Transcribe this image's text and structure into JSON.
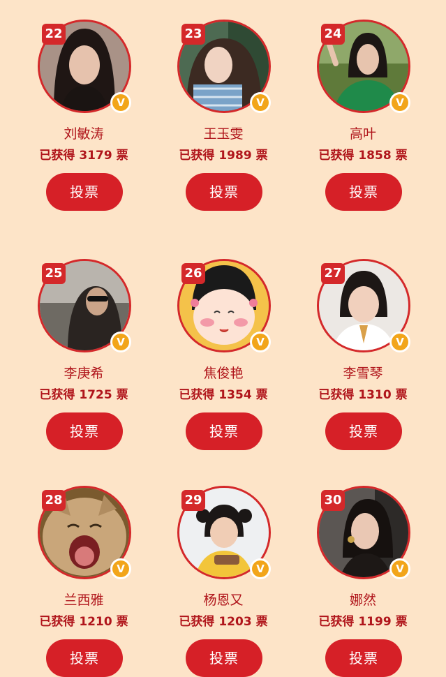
{
  "vote_label": "投票",
  "votes_prefix": "已获得",
  "votes_suffix": "票",
  "verified_glyph": "V",
  "colors": {
    "background": "#fde4c8",
    "accent_red": "#d62027",
    "text_red": "#b0151b",
    "badge_gold": "#f2a51a"
  },
  "candidates": [
    {
      "rank": "22",
      "name": "刘敏涛",
      "votes": "3179",
      "photo": "woman-dark-hair-portrait"
    },
    {
      "rank": "23",
      "name": "王玉雯",
      "votes": "1989",
      "photo": "woman-curly-hair-selfie"
    },
    {
      "rank": "24",
      "name": "高叶",
      "votes": "1858",
      "photo": "woman-green-dress-waving"
    },
    {
      "rank": "25",
      "name": "李庚希",
      "votes": "1725",
      "photo": "person-sunglasses-outdoor"
    },
    {
      "rank": "26",
      "name": "焦俊艳",
      "votes": "1354",
      "photo": "cartoon-girl-pink-cheeks"
    },
    {
      "rank": "27",
      "name": "李雪琴",
      "votes": "1310",
      "photo": "woman-short-hair-smiling"
    },
    {
      "rank": "28",
      "name": "兰西雅",
      "votes": "1210",
      "photo": "cat-yawning"
    },
    {
      "rank": "29",
      "name": "杨恩又",
      "votes": "1203",
      "photo": "little-girl-pigtails"
    },
    {
      "rank": "30",
      "name": "娜然",
      "votes": "1199",
      "photo": "woman-earrings-portrait"
    }
  ]
}
